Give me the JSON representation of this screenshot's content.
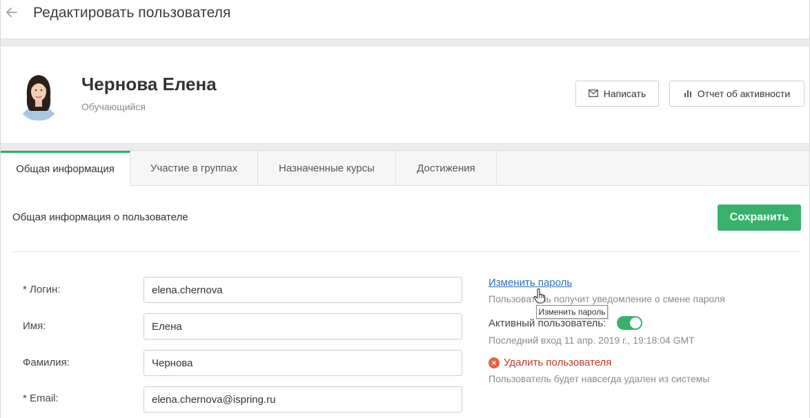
{
  "header": {
    "title": "Редактировать пользователя"
  },
  "profile": {
    "name": "Чернова Елена",
    "role": "Обучающийся",
    "write_button": "Написать",
    "report_button": "Отчет об активности"
  },
  "tabs": [
    {
      "label": "Общая информация",
      "active": true
    },
    {
      "label": "Участие в группах",
      "active": false
    },
    {
      "label": "Назначенные курсы",
      "active": false
    },
    {
      "label": "Достижения",
      "active": false
    }
  ],
  "section": {
    "title": "Общая информация о пользователе",
    "save_button": "Сохранить"
  },
  "form": {
    "login": {
      "label": "* Логин:",
      "value": "elena.chernova"
    },
    "first_name": {
      "label": "Имя:",
      "value": "Елена"
    },
    "last_name": {
      "label": "Фамилия:",
      "value": "Чернова"
    },
    "email": {
      "label": "* Email:",
      "value": "elena.chernova@ispring.ru"
    }
  },
  "side": {
    "change_password_link": "Изменить пароль",
    "change_password_hint": "Пользователь получит уведомление о смене пароля",
    "tooltip": "Изменить пароль",
    "active_label": "Активный пользователь:",
    "active_state": true,
    "last_login": "Последний вход 11 апр. 2019 г., 19:18:04 GMT",
    "delete_link": "Удалить пользователя",
    "delete_hint": "Пользователь будет навсегда удален из системы"
  },
  "colors": {
    "accent": "#38b26a",
    "link": "#2a6ebf",
    "danger": "#c0392b",
    "danger_icon": "#e8613c"
  },
  "icons": {
    "back": "arrow-left-icon",
    "write": "envelope-icon",
    "report": "bar-chart-icon",
    "delete": "close-circle-icon",
    "cursor": "hand-pointer-icon"
  }
}
